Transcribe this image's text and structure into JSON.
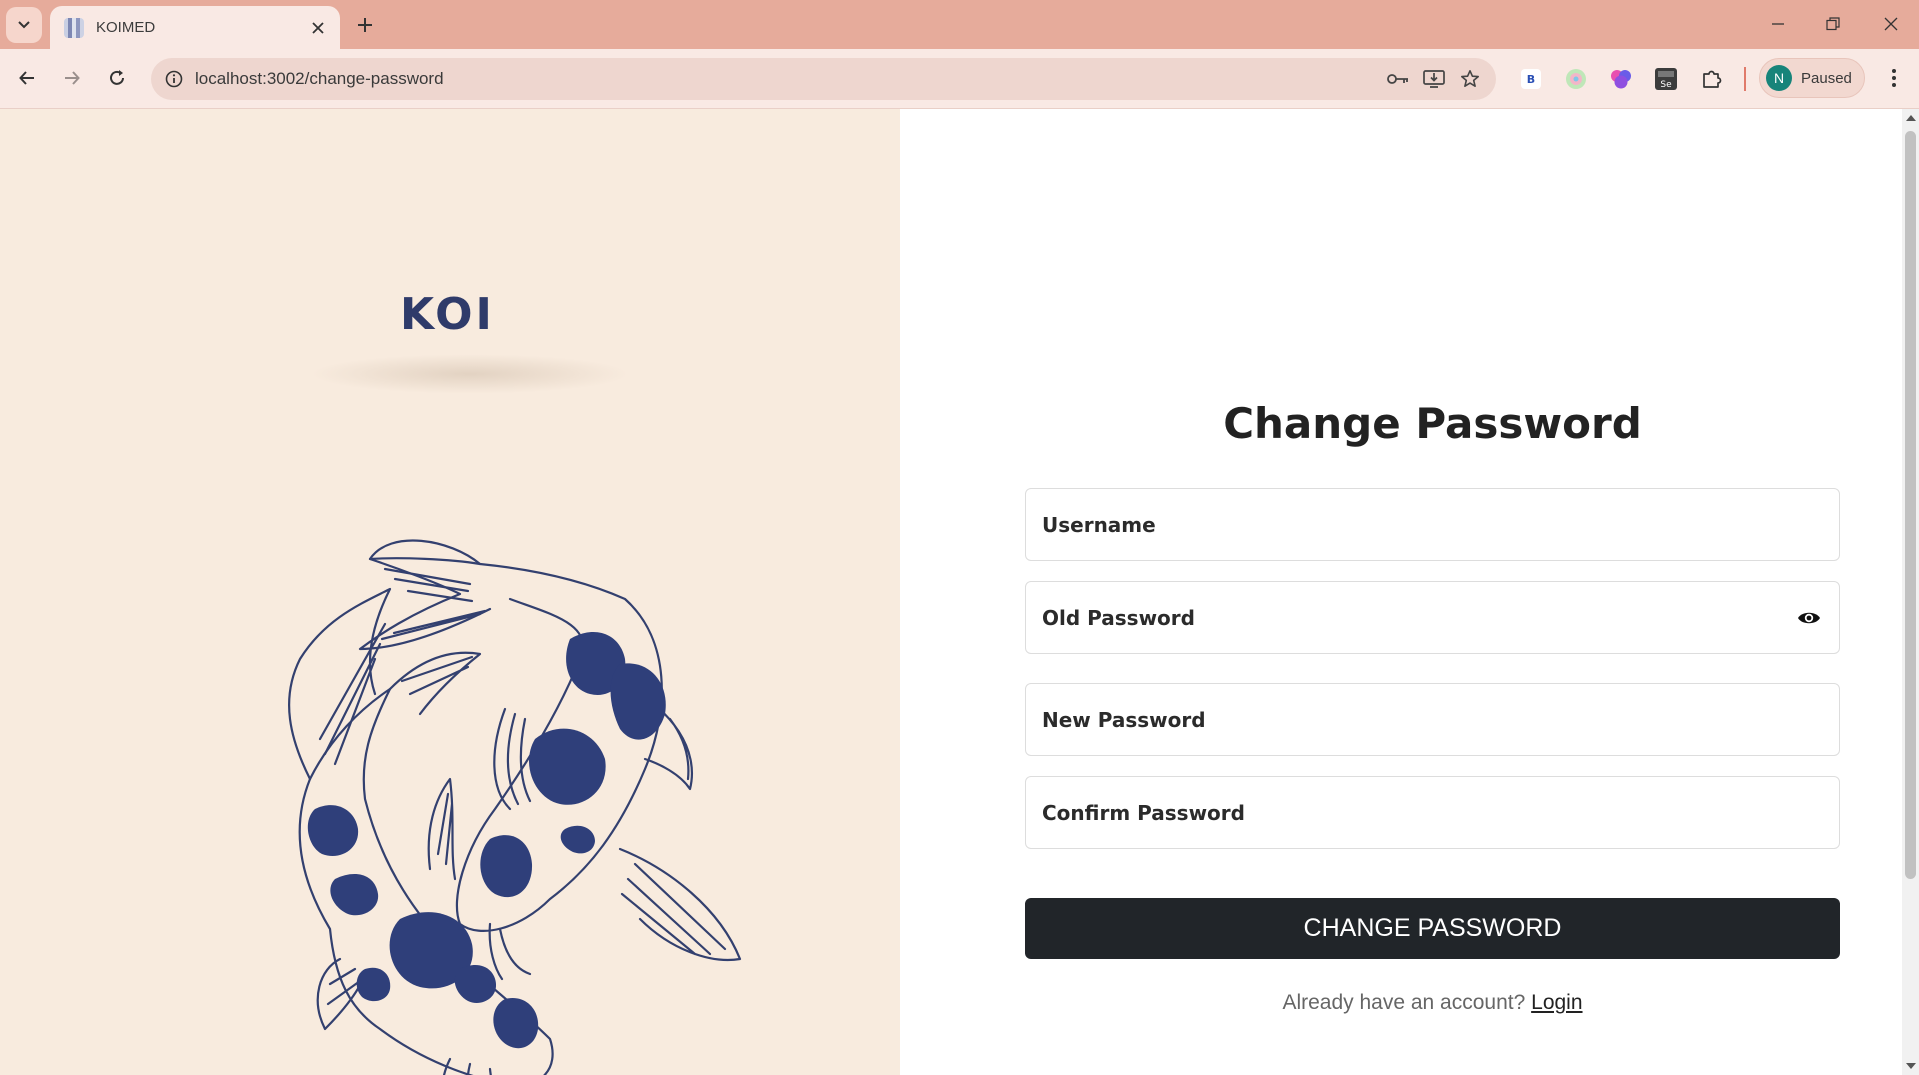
{
  "browser": {
    "tab_title": "KOIMED",
    "url": "localhost:3002/change-password",
    "profile_initial": "N",
    "profile_status": "Paused",
    "extensions": [
      "b-extension-icon",
      "spiral-extension-icon",
      "brain-extension-icon",
      "se-extension-icon",
      "puzzle-icon"
    ]
  },
  "brand": {
    "logo_text": "KOI"
  },
  "form": {
    "title": "Change Password",
    "fields": {
      "username": "Username",
      "old_password": "Old Password",
      "new_password": "New Password",
      "confirm_password": "Confirm Password"
    },
    "submit_label": "CHANGE PASSWORD",
    "footer_prompt": "Already have an account?",
    "login_link": "Login"
  },
  "colors": {
    "tabstrip": "#e6ab9b",
    "toolbar": "#f9e9e4",
    "left_panel": "#f8ebde",
    "koi_spots": "#2f3f7a",
    "button": "#212529"
  }
}
